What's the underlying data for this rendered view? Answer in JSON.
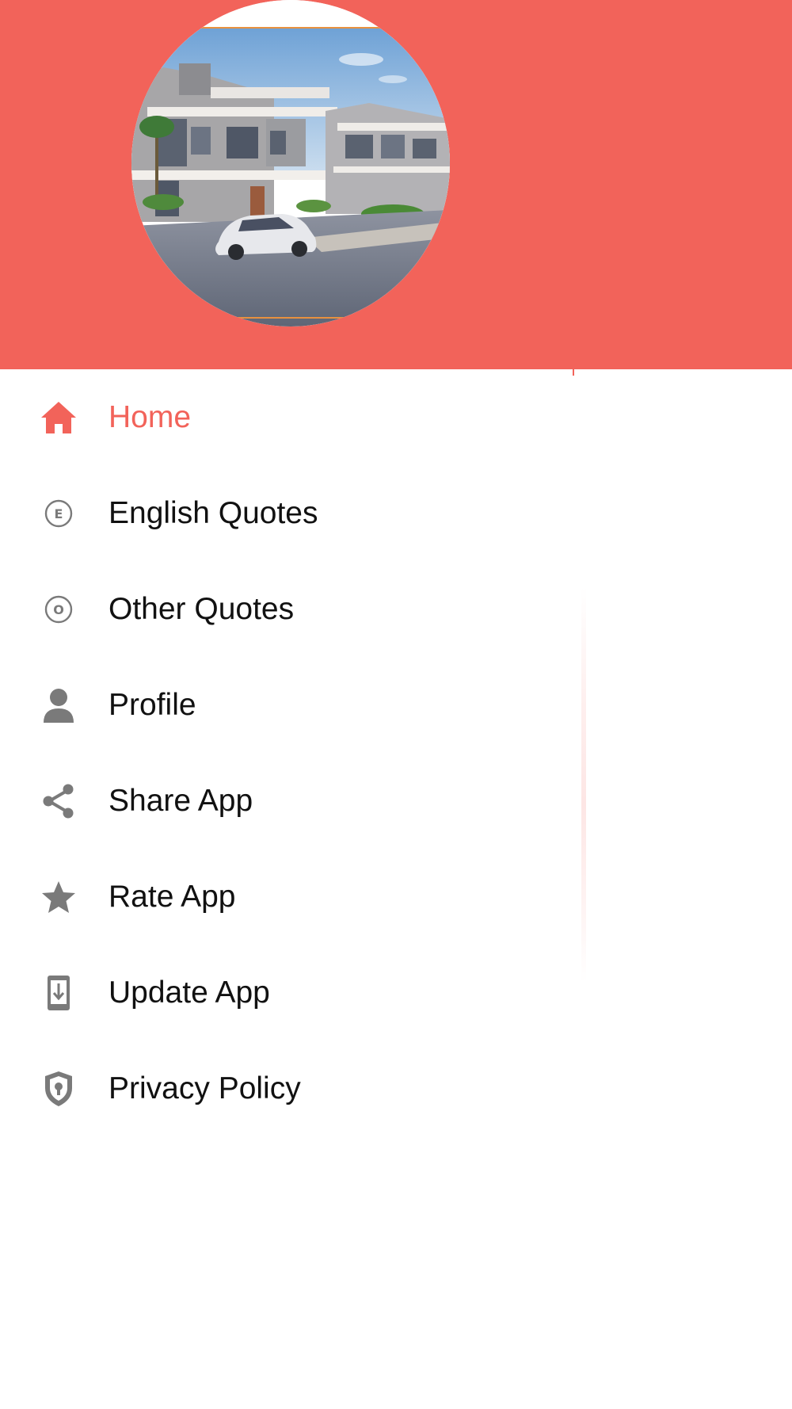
{
  "colors": {
    "accent": "#f2635a",
    "icon_gray": "#7a7a7a",
    "text": "#111111",
    "background": "#ffffff"
  },
  "header": {
    "avatar_image": "house-photo"
  },
  "menu": {
    "items": [
      {
        "label": "Home",
        "icon": "home-icon",
        "active": true
      },
      {
        "label": "English Quotes",
        "icon": "letter-e-circle-icon",
        "active": false
      },
      {
        "label": "Other Quotes",
        "icon": "letter-o-circle-icon",
        "active": false
      },
      {
        "label": "Profile",
        "icon": "person-icon",
        "active": false
      },
      {
        "label": "Share App",
        "icon": "share-icon",
        "active": false
      },
      {
        "label": "Rate App",
        "icon": "star-icon",
        "active": false
      },
      {
        "label": "Update App",
        "icon": "phone-download-icon",
        "active": false
      },
      {
        "label": "Privacy Policy",
        "icon": "shield-lock-icon",
        "active": false
      }
    ]
  }
}
